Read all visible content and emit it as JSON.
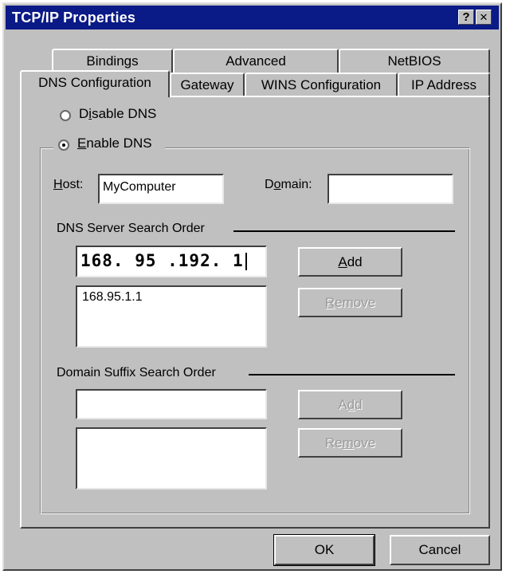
{
  "window": {
    "title": "TCP/IP Properties",
    "help_button": "?",
    "close_button": "✕"
  },
  "tabs": {
    "back_row": [
      "Bindings",
      "Advanced",
      "NetBIOS"
    ],
    "front_row": [
      "DNS Configuration",
      "Gateway",
      "WINS Configuration",
      "IP Address"
    ],
    "active": "DNS Configuration"
  },
  "dns": {
    "disable_pre": "D",
    "disable_u": "i",
    "disable_post": "sable DNS",
    "enable_u": "E",
    "enable_post": "nable DNS",
    "selected": "enable",
    "host_u": "H",
    "host_post": "ost:",
    "host_value": "MyComputer",
    "domain_pre": "D",
    "domain_u": "o",
    "domain_post": "main:",
    "domain_value": "",
    "server_heading": "DNS Server Search Order",
    "server_input": "168. 95 .192. 1",
    "server_add_u": "A",
    "server_add_post": "dd",
    "server_remove_u": "R",
    "server_remove_post": "emove",
    "server_list": [
      "168.95.1.1"
    ],
    "suffix_heading": "Domain Suffix Search Order",
    "suffix_input": "",
    "suffix_add_pre": "A",
    "suffix_add_u": "d",
    "suffix_add_post": "d",
    "suffix_remove_pre": "Re",
    "suffix_remove_u": "m",
    "suffix_remove_post": "ove"
  },
  "footer": {
    "ok_label": "OK",
    "cancel_label": "Cancel"
  },
  "colors": {
    "titlebar": "#0a1a86",
    "face": "#c0c0c0"
  }
}
